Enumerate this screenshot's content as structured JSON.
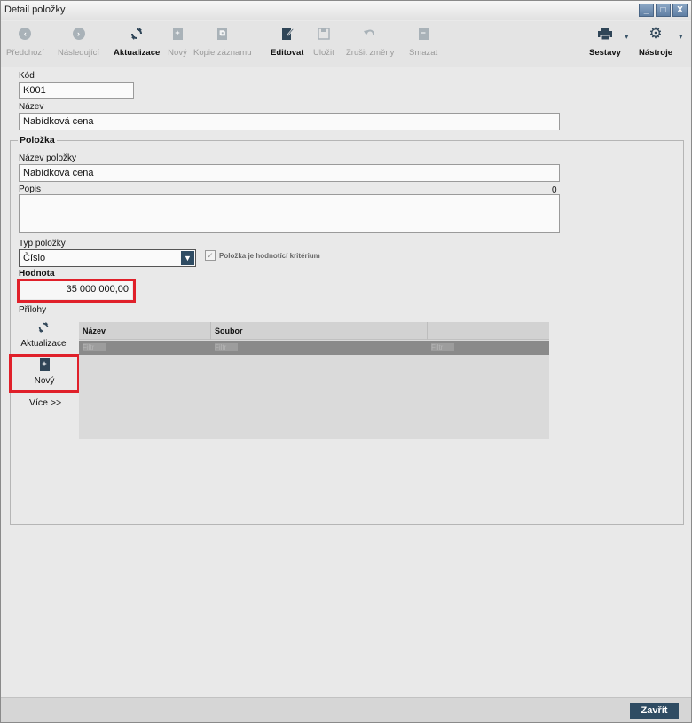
{
  "window": {
    "title": "Detail položky",
    "buttons": [
      "_",
      "□",
      "X"
    ]
  },
  "toolbar": {
    "items": [
      {
        "label": "Předchozí",
        "icon": "arrow-left-circle-icon",
        "active": false
      },
      {
        "label": "Následující",
        "icon": "arrow-right-circle-icon",
        "active": false
      },
      {
        "label": "Aktualizace",
        "icon": "refresh-icon",
        "active": true
      },
      {
        "label": "Nový",
        "icon": "new-document-icon",
        "active": false
      },
      {
        "label": "Kopie záznamu",
        "icon": "copy-record-icon",
        "active": false
      },
      {
        "label": "Editovat",
        "icon": "edit-icon",
        "active": true
      },
      {
        "label": "Uložit",
        "icon": "save-icon",
        "active": false
      },
      {
        "label": "Zrušit změny",
        "icon": "undo-icon",
        "active": false
      },
      {
        "label": "Smazat",
        "icon": "delete-document-icon",
        "active": false
      }
    ],
    "right": [
      {
        "label": "Sestavy",
        "icon": "printer-icon"
      },
      {
        "label": "Nástroje",
        "icon": "gear-icon"
      }
    ]
  },
  "form": {
    "kod_label": "Kód",
    "kod_value": "K001",
    "nazev_label": "Název",
    "nazev_value": "Nabídková cena",
    "section_title": "Položka",
    "nazev_polozky_label": "Název položky",
    "nazev_polozky_value": "Nabídková cena",
    "popis_label": "Popis",
    "popis_count": "0",
    "typ_label": "Typ položky",
    "typ_value": "Číslo",
    "kriterium_label": "Položka je hodnotící kritérium",
    "hodnota_label": "Hodnota",
    "hodnota_value": "35 000 000,00",
    "prilohy_label": "Přílohy"
  },
  "attachments": {
    "actions": {
      "refresh_label": "Aktualizace",
      "new_label": "Nový",
      "more_label": "Více >>"
    },
    "columns": [
      "Název",
      "Soubor",
      ""
    ],
    "filter_placeholders": [
      "Filtr",
      "Filtr",
      "Filtr"
    ]
  },
  "footer": {
    "close_label": "Zavřít"
  },
  "colors": {
    "accent": "#2f4c63",
    "highlight": "#e0202a"
  }
}
